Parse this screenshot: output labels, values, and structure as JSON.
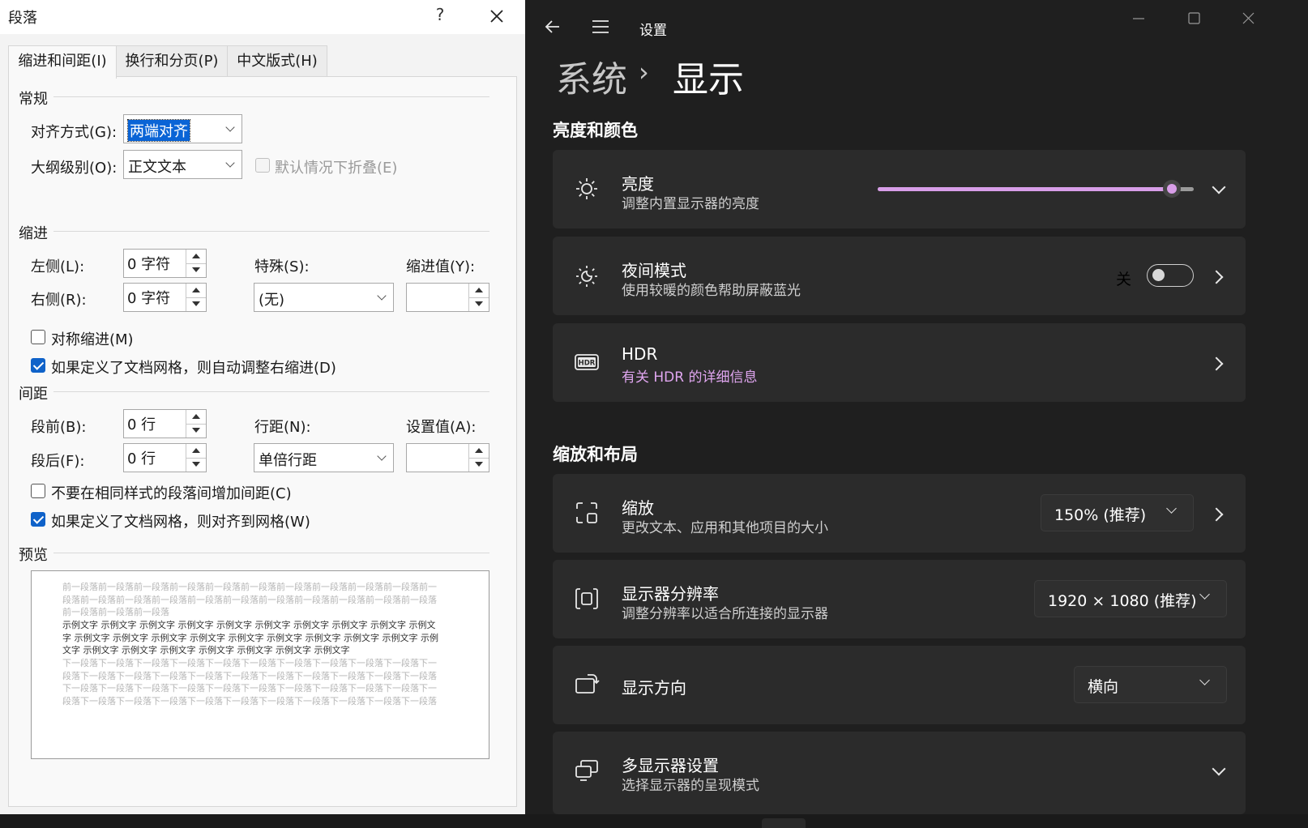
{
  "dialog": {
    "title": "段落",
    "help_label": "?",
    "tabs": [
      {
        "label": "缩进和间距(I)"
      },
      {
        "label": "换行和分页(P)"
      },
      {
        "label": "中文版式(H)"
      }
    ],
    "general": {
      "heading": "常规",
      "alignment_label": "对齐方式(G):",
      "alignment_value": "两端对齐",
      "outline_label": "大纲级别(O):",
      "outline_value": "正文文本",
      "collapse_label": "默认情况下折叠(E)"
    },
    "indent": {
      "heading": "缩进",
      "left_label": "左侧(L):",
      "left_value": "0 字符",
      "right_label": "右侧(R):",
      "right_value": "0 字符",
      "special_label": "特殊(S):",
      "special_value": "(无)",
      "by_label": "缩进值(Y):",
      "by_value": "",
      "mirror_label": "对称缩进(M)",
      "auto_adjust_label": "如果定义了文档网格，则自动调整右缩进(D)"
    },
    "spacing": {
      "heading": "间距",
      "before_label": "段前(B):",
      "before_value": "0 行",
      "after_label": "段后(F):",
      "after_value": "0 行",
      "line_label": "行距(N):",
      "line_value": "单倍行距",
      "at_label": "设置值(A):",
      "at_value": "",
      "no_space_label": "不要在相同样式的段落间增加间距(C)",
      "snap_grid_label": "如果定义了文档网格，则对齐到网格(W)"
    },
    "preview": {
      "heading": "预览",
      "prev_text": "前一段落前一段落前一段落前一段落前一段落前一段落前一段落前一段落前一段落前一段落前一段落前一段落前一段落前一段落前一段落前一段落前一段落前一段落前一段落前一段落前一段落前一段落前一段落前一段落",
      "sample_text": "示例文字 示例文字 示例文字 示例文字 示例文字 示例文字 示例文字 示例文字 示例文字 示例文字 示例文字 示例文字 示例文字 示例文字 示例文字 示例文字 示例文字 示例文字 示例文字 示例文字 示例文字 示例文字 示例文字 示例文字 示例文字 示例文字 示例文字",
      "next_text": "下一段落下一段落下一段落下一段落下一段落下一段落下一段落下一段落下一段落下一段落下一段落下一段落下一段落下一段落下一段落下一段落下一段落下一段落下一段落下一段落下一段落下一段落下一段落下一段落下一段落下一段落下一段落下一段落下一段落下一段落下一段落下一段落下一段落下一段落下一段落下一段落下一段落下一段落下一段落下一段落下一段落下一段落"
    }
  },
  "settings": {
    "app_title": "设置",
    "breadcrumb_parent": "系统",
    "breadcrumb_sep": "›",
    "page_title": "显示",
    "section_brightness": "亮度和颜色",
    "brightness": {
      "title": "亮度",
      "subtitle": "调整内置显示器的亮度",
      "level_percent": 93
    },
    "night_light": {
      "title": "夜间模式",
      "subtitle": "使用较暖的颜色帮助屏蔽蓝光",
      "state": "关"
    },
    "hdr": {
      "title": "HDR",
      "link": "有关 HDR 的详细信息"
    },
    "section_scale": "缩放和布局",
    "scale": {
      "title": "缩放",
      "subtitle": "更改文本、应用和其他项目的大小",
      "value": "150% (推荐)"
    },
    "resolution": {
      "title": "显示器分辨率",
      "subtitle": "调整分辨率以适合所连接的显示器",
      "value": "1920 × 1080 (推荐)"
    },
    "orientation": {
      "title": "显示方向",
      "value": "横向"
    },
    "multi_display": {
      "title": "多显示器设置",
      "subtitle": "选择显示器的呈现模式"
    }
  },
  "colors": {
    "accent": "#d89ee8",
    "link": "#e0a6f0",
    "checkbox": "#0f62c9"
  }
}
